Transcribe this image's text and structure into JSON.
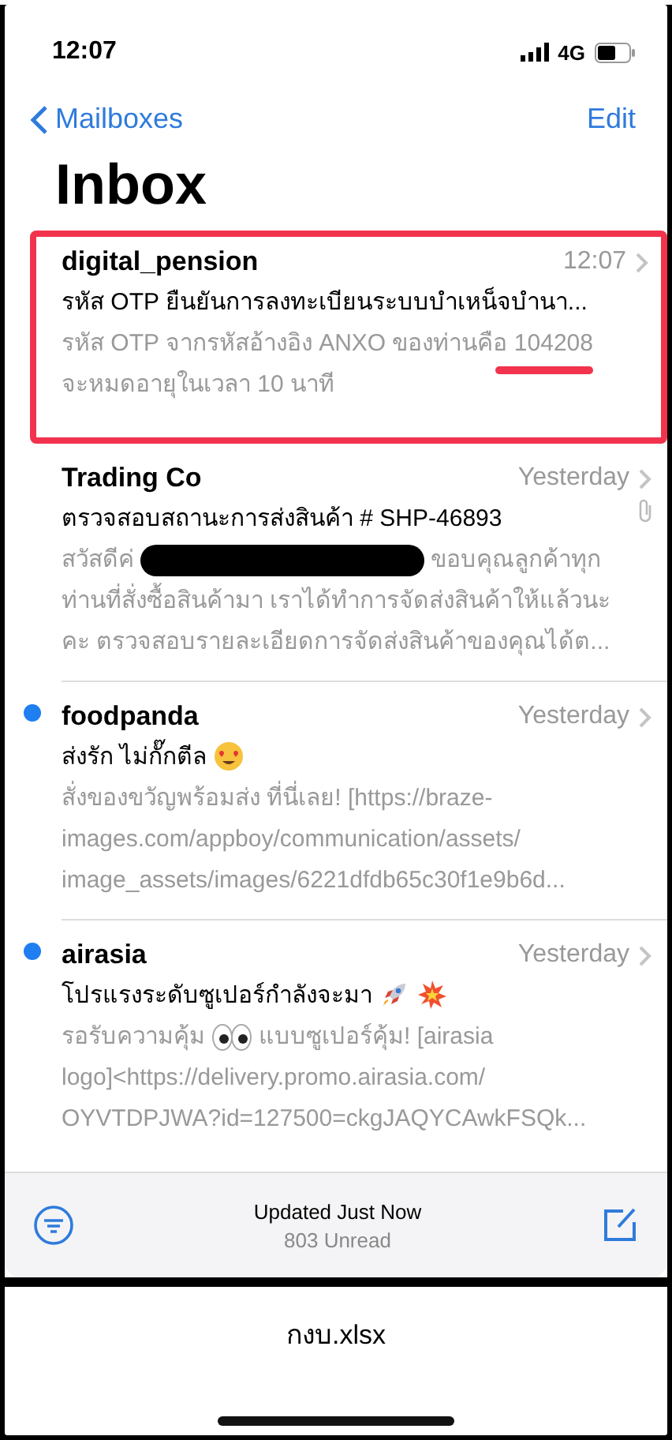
{
  "status_bar": {
    "time": "12:07",
    "network": "4G"
  },
  "nav": {
    "back": "Mailboxes",
    "action": "Edit"
  },
  "title": "Inbox",
  "messages": [
    {
      "sender": "digital_pension",
      "time": "12:07",
      "unread": false,
      "highlighted": true,
      "attachment": false,
      "subject": "รหัส OTP ยืนยันการลงทะเบียนระบบบำเหน็จบำนา...",
      "preview": [
        {
          "parts": [
            "รหัส OTP จากรหัสอ้างอิง ANXO ของท่านคือ 104208"
          ]
        },
        {
          "parts": [
            "จะหมดอายุในเวลา 10 นาที"
          ]
        }
      ]
    },
    {
      "sender": "Trading Co",
      "time": "Yesterday",
      "unread": false,
      "highlighted": false,
      "attachment": true,
      "subject": "ตรวจสอบสถานะการส่งสินค้า # SHP-46893",
      "preview": [
        {
          "parts": [
            "สวัสดีค่",
            "ขอบคุณลูกค้าทุก"
          ],
          "kind": "redaction"
        },
        {
          "parts": [
            "ท่านที่สั่งซื้อสินค้ามา เราได้ทำการจัดส่งสินค้าให้แล้วนะ"
          ]
        },
        {
          "parts": [
            "คะ ตรวจสอบรายละเอียดการจัดส่งสินค้าของคุณได้ต..."
          ]
        }
      ]
    },
    {
      "sender": "foodpanda",
      "time": "Yesterday",
      "unread": true,
      "highlighted": false,
      "attachment": false,
      "subject": "ส่งรัก ไม่กั๊กตีล",
      "subject_icons": [
        {
          "kind": "heart-eyes"
        }
      ],
      "preview": [
        {
          "parts": [
            "สั่งของขวัญพร้อมส่ง ที่นี่เลย! [https://braze-"
          ]
        },
        {
          "parts": [
            "images.com/appboy/communication/assets/"
          ]
        },
        {
          "parts": [
            "image_assets/images/6221dfdb65c30f1e9b6d..."
          ]
        }
      ]
    },
    {
      "sender": "airasia",
      "time": "Yesterday",
      "unread": true,
      "highlighted": false,
      "attachment": false,
      "subject": "โปรแรงระดับซูเปอร์กำลังจะมา",
      "subject_icons": [
        {
          "kind": "rocket"
        },
        {
          "kind": "burst"
        }
      ],
      "preview": [
        {
          "parts": [
            "รอรับความคุ้ม",
            "แบบซูเปอร์คุ้ม! [airasia"
          ],
          "kind": "eyes"
        },
        {
          "parts": [
            "logo]<https://delivery.promo.airasia.com/"
          ]
        },
        {
          "parts": [
            "OYVTDPJWA?id=127500=ckgJAQYCAwkFSQk..."
          ]
        }
      ]
    }
  ],
  "toolbar": {
    "status": "Updated Just Now",
    "unread": "803 Unread"
  },
  "sheet": {
    "filename": "กงบ.xlsx"
  }
}
